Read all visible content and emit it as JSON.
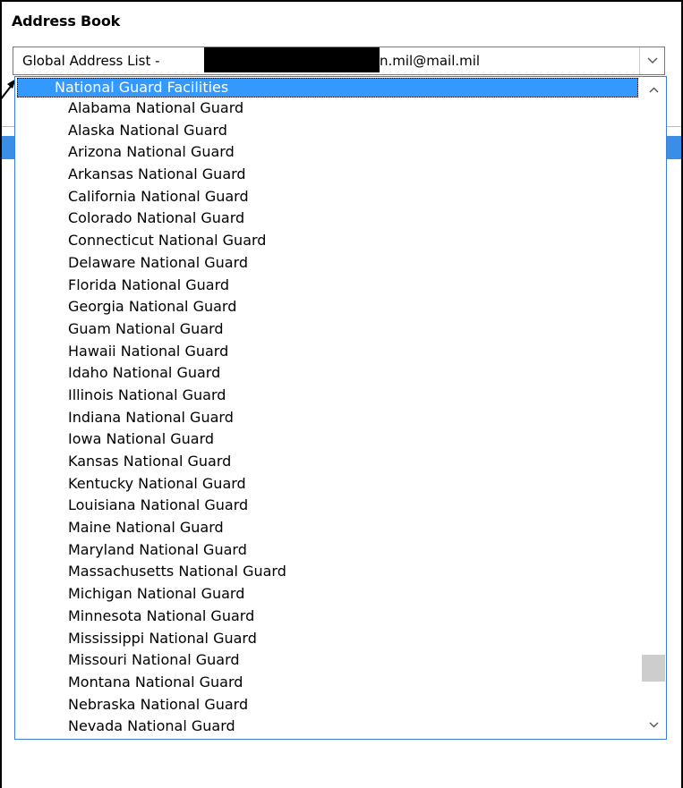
{
  "dialog": {
    "title": "Address Book"
  },
  "combo": {
    "prefix": "Global Address List -",
    "suffix": "n.mil@mail.mil",
    "arrow": "chevron-down-icon"
  },
  "list": {
    "header": "National Guard Facilities",
    "items": [
      "Alabama National Guard",
      "Alaska National Guard",
      "Arizona National Guard",
      "Arkansas National Guard",
      "California National Guard",
      "Colorado National Guard",
      "Connecticut National Guard",
      "Delaware National Guard",
      "Florida National Guard",
      "Georgia National Guard",
      "Guam National Guard",
      "Hawaii National Guard",
      "Idaho National Guard",
      "Illinois National Guard",
      "Indiana National Guard",
      "Iowa National Guard",
      "Kansas National Guard",
      "Kentucky National Guard",
      "Louisiana National Guard",
      "Maine National Guard",
      "Maryland National Guard",
      "Massachusetts National Guard",
      "Michigan National Guard",
      "Minnesota National Guard",
      "Mississippi National Guard",
      "Missouri National Guard",
      "Montana National Guard",
      "Nebraska National Guard",
      "Nevada National Guard"
    ]
  },
  "scrollbar": {
    "up_icon": "chevron-up-icon",
    "down_icon": "chevron-down-icon"
  },
  "colors": {
    "selection": "#3399ff",
    "border": "#3b7fd4",
    "thumb": "#cdcdcd"
  }
}
